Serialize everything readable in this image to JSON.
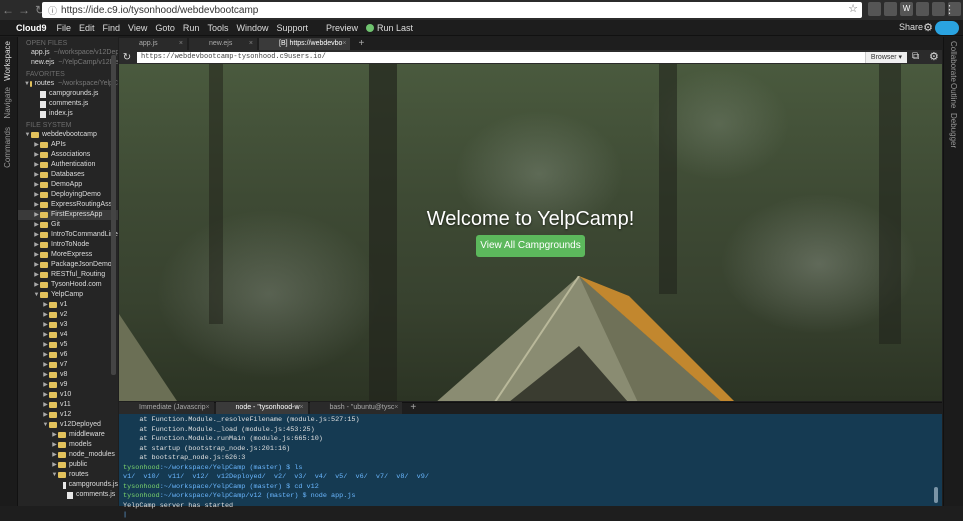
{
  "browser": {
    "url": "https://ide.c9.io/tysonhood/webdevbootcamp",
    "extensions": [
      "",
      "",
      "W",
      "",
      "",
      "",
      "",
      ""
    ]
  },
  "menubar": {
    "brand": "Cloud9",
    "items": [
      "File",
      "Edit",
      "Find",
      "View",
      "Goto",
      "Run",
      "Tools",
      "Window",
      "Support"
    ],
    "preview": "Preview",
    "run_last": "Run Last",
    "share": "Share"
  },
  "left_rail": [
    "Workspace",
    "Navigate",
    "Commands"
  ],
  "right_rail": [
    "Collaborate",
    "Outline",
    "Debugger"
  ],
  "tree": {
    "open_files_label": "OPEN FILES",
    "open_files": [
      {
        "name": "app.js",
        "path": "~/workspace/v12Deployed"
      },
      {
        "name": "new.ejs",
        "path": "~/YelpCamp/v12Deployed"
      }
    ],
    "favorites_label": "FAVORITES",
    "favorites": [
      {
        "name": "routes",
        "path": "~/workspace/YelpC",
        "kind": "folder",
        "depth": 0,
        "open": true
      },
      {
        "name": "campgrounds.js",
        "kind": "file",
        "depth": 1
      },
      {
        "name": "comments.js",
        "kind": "file",
        "depth": 1
      },
      {
        "name": "index.js",
        "kind": "file",
        "depth": 1
      }
    ],
    "filesystem_label": "FILE SYSTEM",
    "items": [
      {
        "name": "webdevbootcamp",
        "kind": "folder",
        "depth": 0,
        "open": true
      },
      {
        "name": "APIs",
        "kind": "folder",
        "depth": 1
      },
      {
        "name": "Associations",
        "kind": "folder",
        "depth": 1
      },
      {
        "name": "Authentication",
        "kind": "folder",
        "depth": 1
      },
      {
        "name": "Databases",
        "kind": "folder",
        "depth": 1
      },
      {
        "name": "DemoApp",
        "kind": "folder",
        "depth": 1
      },
      {
        "name": "DeployingDemo",
        "kind": "folder",
        "depth": 1
      },
      {
        "name": "ExpressRoutingAss",
        "kind": "folder",
        "depth": 1
      },
      {
        "name": "FirstExpressApp",
        "kind": "folder",
        "depth": 1,
        "selected": true
      },
      {
        "name": "Git",
        "kind": "folder",
        "depth": 1
      },
      {
        "name": "IntroToCommandLine",
        "kind": "folder",
        "depth": 1
      },
      {
        "name": "IntroToNode",
        "kind": "folder",
        "depth": 1
      },
      {
        "name": "MoreExpress",
        "kind": "folder",
        "depth": 1
      },
      {
        "name": "PackageJsonDemo",
        "kind": "folder",
        "depth": 1
      },
      {
        "name": "RESTful_Routing",
        "kind": "folder",
        "depth": 1
      },
      {
        "name": "TysonHood.com",
        "kind": "folder",
        "depth": 1
      },
      {
        "name": "YelpCamp",
        "kind": "folder",
        "depth": 1,
        "open": true
      },
      {
        "name": "v1",
        "kind": "folder",
        "depth": 2
      },
      {
        "name": "v2",
        "kind": "folder",
        "depth": 2
      },
      {
        "name": "v3",
        "kind": "folder",
        "depth": 2
      },
      {
        "name": "v4",
        "kind": "folder",
        "depth": 2
      },
      {
        "name": "v5",
        "kind": "folder",
        "depth": 2
      },
      {
        "name": "v6",
        "kind": "folder",
        "depth": 2
      },
      {
        "name": "v7",
        "kind": "folder",
        "depth": 2
      },
      {
        "name": "v8",
        "kind": "folder",
        "depth": 2
      },
      {
        "name": "v9",
        "kind": "folder",
        "depth": 2
      },
      {
        "name": "v10",
        "kind": "folder",
        "depth": 2
      },
      {
        "name": "v11",
        "kind": "folder",
        "depth": 2
      },
      {
        "name": "v12",
        "kind": "folder",
        "depth": 2
      },
      {
        "name": "v12Deployed",
        "kind": "folder",
        "depth": 2,
        "open": true
      },
      {
        "name": "middleware",
        "kind": "folder",
        "depth": 3
      },
      {
        "name": "models",
        "kind": "folder",
        "depth": 3
      },
      {
        "name": "node_modules",
        "kind": "folder",
        "depth": 3
      },
      {
        "name": "public",
        "kind": "folder",
        "depth": 3
      },
      {
        "name": "routes",
        "kind": "folder",
        "depth": 3,
        "open": true
      },
      {
        "name": "campgrounds.js",
        "kind": "file",
        "depth": 4
      },
      {
        "name": "comments.js",
        "kind": "file",
        "depth": 4
      }
    ]
  },
  "editor_tabs": [
    {
      "label": "app.js",
      "active": false
    },
    {
      "label": "new.ejs",
      "active": false
    },
    {
      "label": "[B] https://webdevbo",
      "active": true
    }
  ],
  "preview_bar": {
    "url": "https://webdevbootcamp-tysonhood.c9users.io/",
    "browser_label": "Browser"
  },
  "page": {
    "heading": "Welcome to YelpCamp!",
    "button": "View All Campgrounds",
    "button_color": "#5cb85c"
  },
  "terminal_tabs": [
    {
      "label": "Immediate (Javascrip",
      "active": false
    },
    {
      "label": "node - \"tysonhood-w",
      "active": true
    },
    {
      "label": "bash - \"ubuntu@tysc",
      "active": false
    }
  ],
  "terminal": [
    {
      "text": "    at Function.Module._resolveFilename (module.js:527:15)",
      "cls": ""
    },
    {
      "text": "    at Function.Module._load (module.js:453:25)",
      "cls": ""
    },
    {
      "text": "    at Function.Module.runMain (module.js:665:10)",
      "cls": ""
    },
    {
      "text": "    at startup (bootstrap_node.js:201:16)",
      "cls": ""
    },
    {
      "text": "    at bootstrap_node.js:626:3",
      "cls": ""
    },
    {
      "segments": [
        {
          "t": "tysonhood",
          "c": "g"
        },
        {
          "t": ":~/workspace/YelpCamp (master) $ ls",
          "c": "b"
        }
      ]
    },
    {
      "text": "v1/  v10/  v11/  v12/  v12Deployed/  v2/  v3/  v4/  v5/  v6/  v7/  v8/  v9/",
      "cls": "b"
    },
    {
      "segments": [
        {
          "t": "tysonhood",
          "c": "g"
        },
        {
          "t": ":~/workspace/YelpCamp (master) $ cd v12",
          "c": "b"
        }
      ]
    },
    {
      "segments": [
        {
          "t": "tysonhood",
          "c": "g"
        },
        {
          "t": ":~/workspace/YelpCamp/v12 (master) $ node app.js",
          "c": "b"
        }
      ]
    },
    {
      "text": "YelpCamp server has started",
      "cls": ""
    },
    {
      "text": "|",
      "cls": "b"
    }
  ]
}
